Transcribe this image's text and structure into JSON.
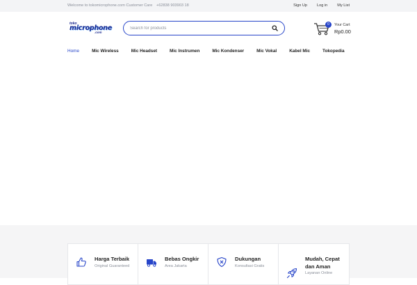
{
  "topbar": {
    "welcome": "Welcome to tokomicrophone.com Customer Care",
    "phone": "+62838 903903 18",
    "links": [
      "Sign Up",
      "Log in",
      "My List"
    ]
  },
  "logo": {
    "small": "toko",
    "big": "microphone",
    "domain": ".com"
  },
  "search": {
    "placeholder": "Search for products",
    "value": ""
  },
  "cart": {
    "count": "0",
    "label": "Your Cart",
    "total": "Rp0.00"
  },
  "nav": {
    "items": [
      {
        "label": "Home",
        "active": true
      },
      {
        "label": "Mic Wireless"
      },
      {
        "label": "Mic Headset"
      },
      {
        "label": "Mic Instrumen"
      },
      {
        "label": "Mic Kondenser"
      },
      {
        "label": "Mic Vokal"
      },
      {
        "label": "Kabel Mic"
      },
      {
        "label": "Tokopedia"
      }
    ]
  },
  "features": [
    {
      "title": "Harga Terbaik",
      "subtitle": "Original Guaranteed",
      "icon": "thumbs-up-icon"
    },
    {
      "title": "Bebas Ongkir",
      "subtitle": "Area Jakarta",
      "icon": "truck-icon"
    },
    {
      "title": "Dukungan",
      "subtitle": "Konsultasi Gratis",
      "icon": "shield-icon"
    },
    {
      "title": "Mudah, Cepat dan Aman",
      "subtitle": "Layanan Online",
      "icon": "rocket-icon"
    }
  ],
  "colors": {
    "accent": "#2745c9",
    "topbar_bg": "#f3f4f6",
    "muted_text": "#8a8f99"
  }
}
